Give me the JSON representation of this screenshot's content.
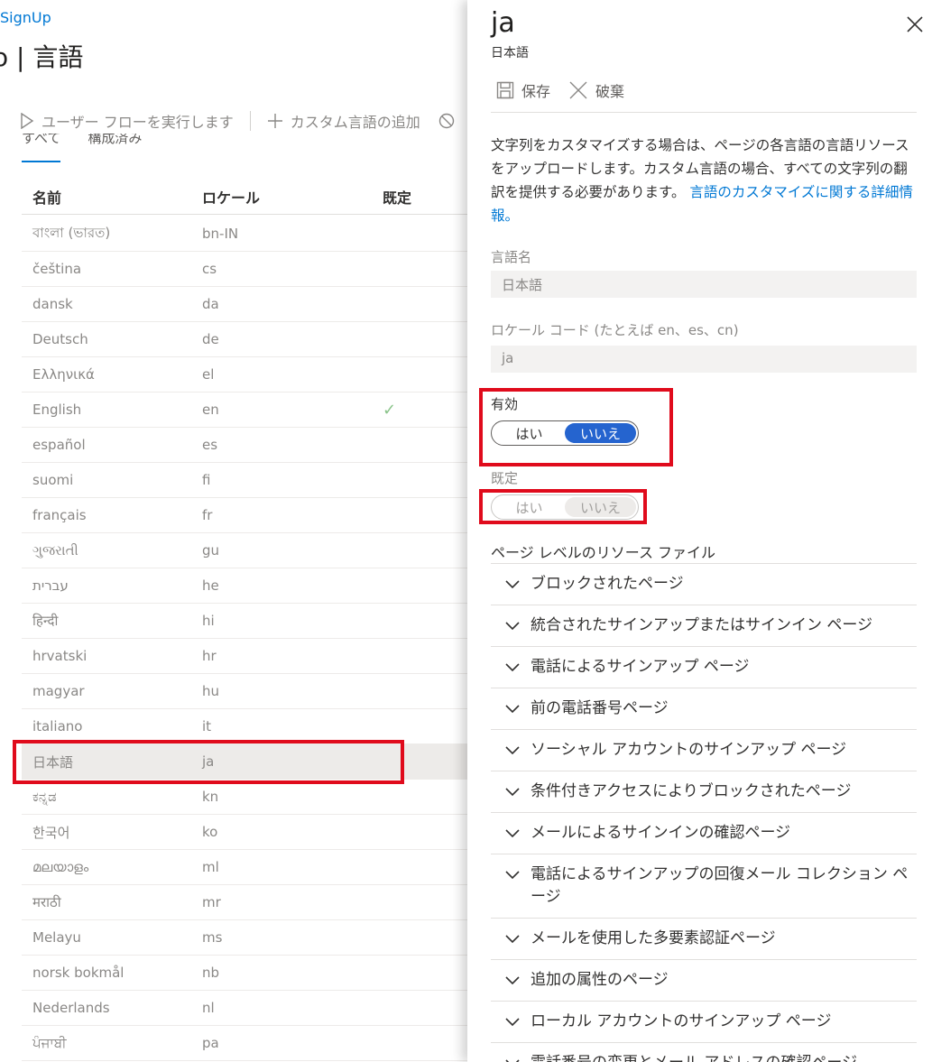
{
  "background": {
    "breadcrumb": "SignUp",
    "title": "o | 言語",
    "commands": {
      "run_flow": "ユーザー フローを実行します",
      "add_language": "カスタム言語の追加"
    },
    "tabs": [
      "すべて",
      "構成済み"
    ],
    "columns": {
      "name": "名前",
      "locale": "ロケール",
      "default": "既定"
    },
    "rows": [
      {
        "name": "বাংলা (ভারত)",
        "locale": "bn-IN"
      },
      {
        "name": "čeština",
        "locale": "cs"
      },
      {
        "name": "dansk",
        "locale": "da"
      },
      {
        "name": "Deutsch",
        "locale": "de"
      },
      {
        "name": "Ελληνικά",
        "locale": "el"
      },
      {
        "name": "English",
        "locale": "en",
        "default": "✓"
      },
      {
        "name": "español",
        "locale": "es"
      },
      {
        "name": "suomi",
        "locale": "fi"
      },
      {
        "name": "français",
        "locale": "fr"
      },
      {
        "name": "ગુજરાતી",
        "locale": "gu"
      },
      {
        "name": "עברית",
        "locale": "he"
      },
      {
        "name": "हिन्दी",
        "locale": "hi"
      },
      {
        "name": "hrvatski",
        "locale": "hr"
      },
      {
        "name": "magyar",
        "locale": "hu"
      },
      {
        "name": "italiano",
        "locale": "it"
      },
      {
        "name": "日本語",
        "locale": "ja"
      },
      {
        "name": "ಕನ್ನಡ",
        "locale": "kn"
      },
      {
        "name": "한국어",
        "locale": "ko"
      },
      {
        "name": "മലയാളം",
        "locale": "ml"
      },
      {
        "name": "मराठी",
        "locale": "mr"
      },
      {
        "name": "Melayu",
        "locale": "ms"
      },
      {
        "name": "norsk bokmål",
        "locale": "nb"
      },
      {
        "name": "Nederlands",
        "locale": "nl"
      },
      {
        "name": "ਪੰਜਾਬੀ",
        "locale": "pa"
      }
    ],
    "selected_locale": "ja"
  },
  "panel": {
    "title": "ja",
    "subtitle": "日本語",
    "toolbar": {
      "save": "保存",
      "discard": "破棄"
    },
    "description": "文字列をカスタマイズする場合は、ページの各言語の言語リソースをアップロードします。カスタム言語の場合、すべての文字列の翻訳を提供する必要があります。",
    "description_link": "言語のカスタマイズに関する詳細情報。",
    "language_name_label": "言語名",
    "language_name_value": "日本語",
    "locale_code_label": "ロケール コード (たとえば en、es、cn)",
    "locale_code_value": "ja",
    "enabled": {
      "label": "有効",
      "yes": "はい",
      "no": "いいえ",
      "selected": "no"
    },
    "default": {
      "label": "既定",
      "yes": "はい",
      "no": "いいえ",
      "selected": "no",
      "disabled": true
    },
    "resources_title": "ページ レベルのリソース ファイル",
    "resources": [
      "ブロックされたページ",
      "統合されたサインアップまたはサインイン ページ",
      "電話によるサインアップ ページ",
      "前の電話番号ページ",
      "ソーシャル アカウントのサインアップ ページ",
      "条件付きアクセスによりブロックされたページ",
      "メールによるサインインの確認ページ",
      "電話によるサインアップの回復メール コレクション ページ",
      "メールを使用した多要素認証ページ",
      "追加の属性のページ",
      "ローカル アカウントのサインアップ ページ",
      "電話番号の変更とメール アドレスの確認ページ"
    ]
  },
  "colors": {
    "accent": "#0078d4",
    "toggle_selected": "#2564cf",
    "highlight": "#e00b1c"
  }
}
